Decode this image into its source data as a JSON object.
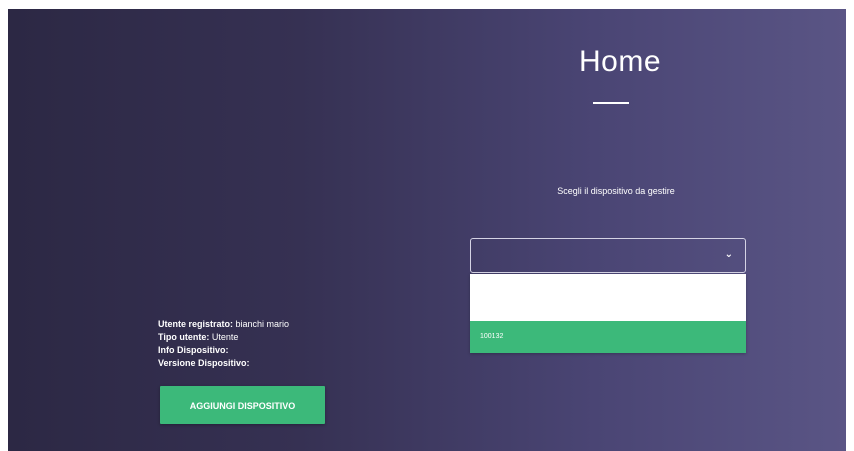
{
  "page": {
    "title": "Home",
    "instruction": "Scegli il dispositivo da gestire"
  },
  "device_select": {
    "selected_value": "",
    "options": [
      "",
      "100132"
    ]
  },
  "user_info": {
    "registered_label": "Utente registrato:",
    "registered_value": "bianchi mario",
    "type_label": "Tipo utente:",
    "type_value": "Utente",
    "device_info_label": "Info Dispositivo:",
    "device_version_label": "Versione Dispositivo:"
  },
  "actions": {
    "add_device_label": "AGGIUNGI DISPOSITIVO"
  },
  "colors": {
    "accent": "#3cb97a",
    "background_left": "#2c2844",
    "background_right": "#5a5585"
  },
  "icons": {
    "dropdown": "chevron-down-icon"
  }
}
